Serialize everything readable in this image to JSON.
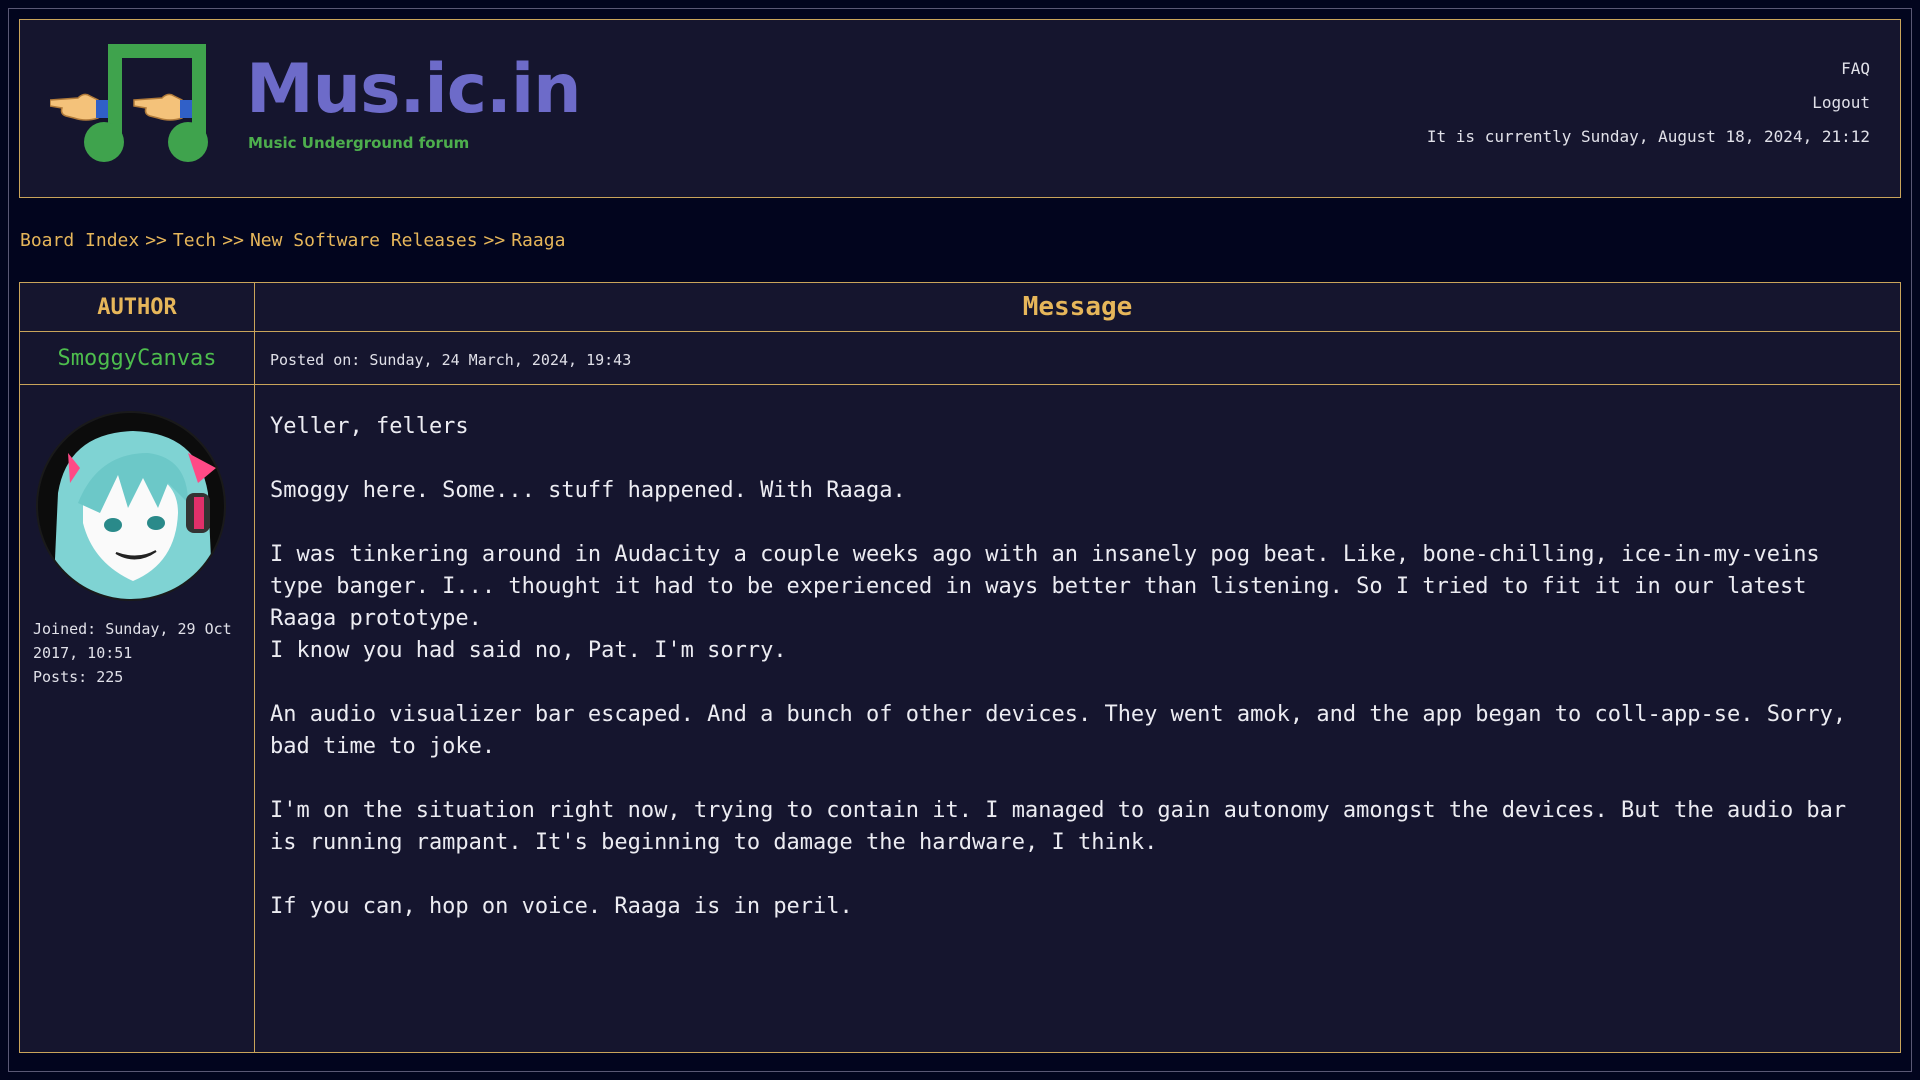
{
  "site": {
    "title": "Mus.ic.in",
    "subtitle": "Music Underground forum"
  },
  "header_links": {
    "faq": "FAQ",
    "logout": "Logout",
    "current_time": "It is currently Sunday, August 18, 2024, 21:12"
  },
  "breadcrumb": {
    "items": [
      "Board Index",
      "Tech",
      "New Software Releases",
      "Raaga"
    ],
    "separator": ">>"
  },
  "table": {
    "author_header": "AUTHOR",
    "message_header": "Message"
  },
  "post": {
    "author": "SmoggyCanvas",
    "posted_on": "Posted on: Sunday, 24 March, 2024, 19:43",
    "joined_line1": "Joined: Sunday, 29 Oct",
    "joined_line2": "2017, 10:51",
    "posts": "Posts: 225",
    "body": {
      "p1": "Yeller, fellers",
      "p2": "Smoggy here. Some... stuff happened. With Raaga.",
      "p3": "I was tinkering around in Audacity a couple weeks ago with an insanely pog  beat. Like, bone-chilling, ice-in-my-veins type banger. I... thought it had to be experienced in ways better than listening. So I tried to fit it in our latest Raaga prototype.",
      "p4": "I know you had said no, Pat. I'm sorry.",
      "p5": "An audio visualizer bar escaped. And a bunch of other devices. They went amok, and the app began to coll-app-se. Sorry, bad time to joke.",
      "p6": "I'm on the situation right now, trying to contain it. I managed to gain autonomy amongst the devices. But the audio bar is running rampant. It's beginning to damage the hardware, I think.",
      "p7": "If you can, hop on voice. Raaga is in peril."
    }
  },
  "colors": {
    "background": "#02051e",
    "panel": "#15152e",
    "border": "#c9a45a",
    "accent_gold": "#e6b65a",
    "brand_purple": "#6d6bc9",
    "brand_green": "#4dae4d"
  },
  "icons": [
    "music-note-logo-icon",
    "pointing-hand-icon",
    "avatar-image"
  ]
}
